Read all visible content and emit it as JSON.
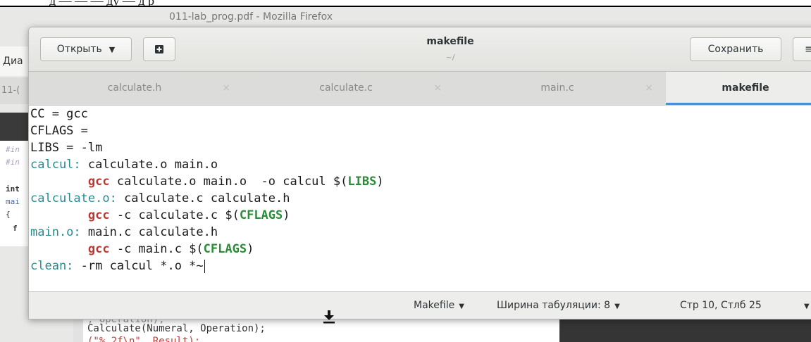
{
  "background": {
    "doc_top_text": "д — — — ду — д р",
    "firefox_title": "011-lab_prog.pdf - Mozilla Firefox",
    "firefox_toolbar_fragment": "Диа",
    "firefox_tab_fragment": "11-(",
    "pdf_left_lines": [
      "#in",
      "#in",
      "int",
      "mai",
      "{",
      "f"
    ],
    "bg_code_lines": [
      ", Operation);",
      "Calculate(Numeral, Operation);",
      "(\"%.2f\\n\", Result);"
    ]
  },
  "header": {
    "open_label": "Открыть",
    "title": "makefile",
    "subtitle": "~/",
    "save_label": "Сохранить",
    "menu_glyph": "≡"
  },
  "tabs": [
    {
      "label": "calculate.h",
      "close": "×"
    },
    {
      "label": "calculate.c",
      "close": "×"
    },
    {
      "label": "main.c",
      "close": "×"
    },
    {
      "label": "makefile",
      "close": ""
    }
  ],
  "code": {
    "l1": "CC = gcc",
    "l2": "CFLAGS =",
    "l3": "LIBS = -lm",
    "l4_target": "calcul:",
    "l4_rest": " calculate.o main.o",
    "l5_indent": "        ",
    "l5_kw": "gcc",
    "l5_mid": " calculate.o main.o  -o calcul $(",
    "l5_var": "LIBS",
    "l5_end": ")",
    "l6_target": "calculate.o:",
    "l6_rest": " calculate.c calculate.h",
    "l7_indent": "        ",
    "l7_kw": "gcc",
    "l7_mid": " -c calculate.c $(",
    "l7_var": "CFLAGS",
    "l7_end": ")",
    "l8_target": "main.o:",
    "l8_rest": " main.c calculate.h",
    "l9_indent": "        ",
    "l9_kw": "gcc",
    "l9_mid": " -c main.c $(",
    "l9_var": "CFLAGS",
    "l9_end": ")",
    "l10_target": "clean:",
    "l10_rest": " -rm calcul *.o *~"
  },
  "status": {
    "language": "Makefile",
    "tab_width": "Ширина табуляции: 8",
    "position": "Стр 10, Стлб 25"
  },
  "colors": {
    "target": "#2a8a8e",
    "keyword": "#c0362c",
    "variable": "#2b8c3a",
    "active_tab_underline": "#4a90d9"
  }
}
